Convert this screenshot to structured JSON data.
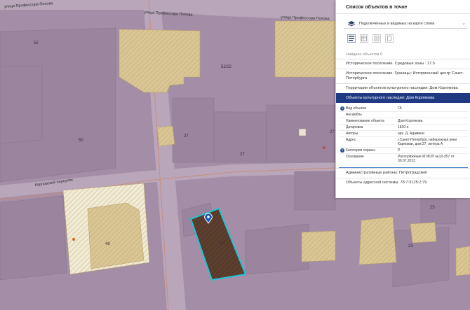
{
  "map": {
    "streets": {
      "top_left": "улица Профессора Попова",
      "top_mid": "улица Профессора Попова",
      "top_right": "улица Профессора Попова",
      "karpovka": "Карповский переулок"
    },
    "building_numbers": {
      "b52": "52",
      "b53_22": "53/22",
      "b50": "50",
      "b27a": "27",
      "b27b": "27",
      "b27c": "27",
      "b27d": "27",
      "b48": "48",
      "b25": "25",
      "b23": "23"
    },
    "marker": "location-pin-icon",
    "colors": {
      "background": "#a58fa8",
      "building": "#9a849e",
      "heritage_hatch": "#d9c695",
      "selected_parcel": "#5c3f2e",
      "selected_outline": "#22c3d4",
      "street": "#c4b3c6",
      "zone_line": "#c98e7a"
    }
  },
  "panel": {
    "title": "Список объектов в точке",
    "layer_select": "Подключённых и видимых на карте слоёв",
    "found": "Найдено объектов 6",
    "rows": [
      {
        "label": "Историческое поселение. Средовые зоны : 17.5"
      },
      {
        "label": "Историческое поселение. Границы: Исторический центр Санкт-Петербурга"
      },
      {
        "label": "Территории объектов культурного наследия: Дом Корлякова"
      },
      {
        "label": "Объекты культурного наследия: Дом Корлякова"
      }
    ],
    "details": [
      {
        "key": "Вид объекта",
        "value": "ГА"
      },
      {
        "key": "Ансамбль",
        "value": ""
      },
      {
        "key": "Наименование объекта",
        "value": "Дом Корлякова"
      },
      {
        "key": "Датировка",
        "value": "1820-е"
      },
      {
        "key": "Авторы",
        "value": "арх. Д. Адамини"
      },
      {
        "key": "Адрес",
        "value": "г.Санкт-Петербург, набережная реки Карповки, дом 27, литера А"
      },
      {
        "key": "Категория охраны",
        "value": "Р"
      },
      {
        "key": "Основание",
        "value": "Распоряжение КГИОП №10-357 от 30.07.2013"
      }
    ],
    "bottom_rows": [
      {
        "label": "Административные районы: Петроградский"
      },
      {
        "label": "Объекты адресной системы: 78:7:3125:2:79"
      }
    ]
  }
}
